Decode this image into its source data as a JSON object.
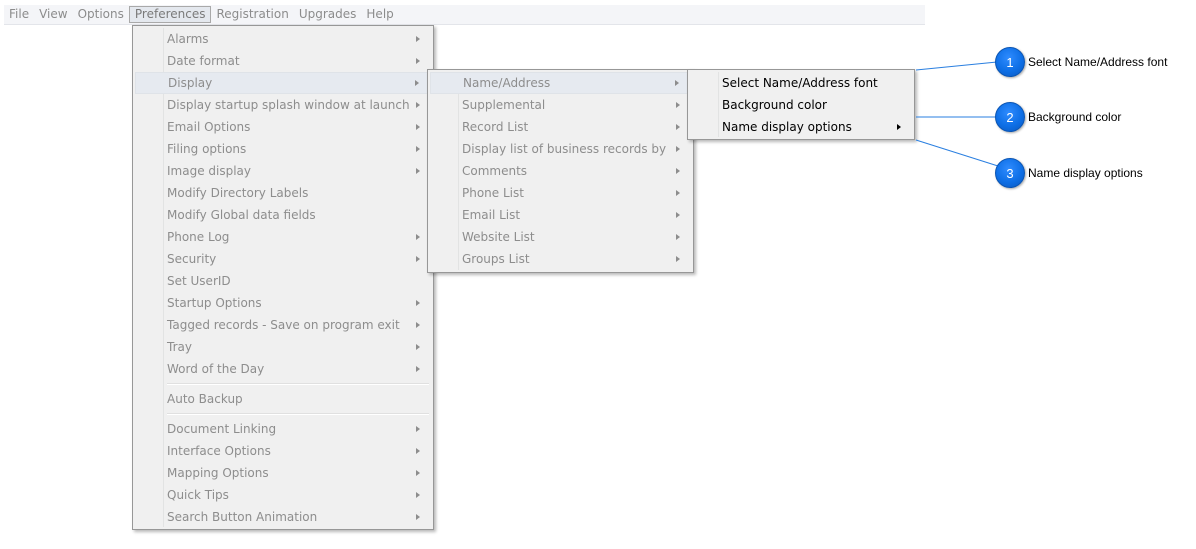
{
  "menubar": {
    "items": [
      {
        "label": "File"
      },
      {
        "label": "View"
      },
      {
        "label": "Options"
      },
      {
        "label": "Preferences"
      },
      {
        "label": "Registration"
      },
      {
        "label": "Upgrades"
      },
      {
        "label": "Help"
      }
    ]
  },
  "preferences_menu": {
    "items": [
      {
        "label": "Alarms"
      },
      {
        "label": "Date format"
      },
      {
        "label": "Display"
      },
      {
        "label": "Display startup splash window at launch"
      },
      {
        "label": "Email Options"
      },
      {
        "label": "Filing options"
      },
      {
        "label": "Image display"
      },
      {
        "label": "Modify Directory Labels"
      },
      {
        "label": "Modify Global data fields"
      },
      {
        "label": "Phone Log"
      },
      {
        "label": "Security"
      },
      {
        "label": "Set UserID"
      },
      {
        "label": "Startup Options"
      },
      {
        "label": "Tagged records - Save on program exit"
      },
      {
        "label": "Tray"
      },
      {
        "label": "Word of the Day"
      },
      {
        "label": "Auto Backup"
      },
      {
        "label": "Document Linking"
      },
      {
        "label": "Interface Options"
      },
      {
        "label": "Mapping Options"
      },
      {
        "label": "Quick Tips"
      },
      {
        "label": "Search Button Animation"
      }
    ]
  },
  "display_menu": {
    "items": [
      {
        "label": "Name/Address"
      },
      {
        "label": "Supplemental"
      },
      {
        "label": "Record List"
      },
      {
        "label": "Display list of business records by"
      },
      {
        "label": "Comments"
      },
      {
        "label": "Phone List"
      },
      {
        "label": "Email List"
      },
      {
        "label": "Website List"
      },
      {
        "label": "Groups List"
      }
    ]
  },
  "name_address_menu": {
    "items": [
      {
        "label": "Select Name/Address font"
      },
      {
        "label": "Background color"
      },
      {
        "label": "Name display options"
      }
    ]
  },
  "callouts": [
    {
      "number": "1",
      "text": "Select Name/Address font"
    },
    {
      "number": "2",
      "text": "Background color"
    },
    {
      "number": "3",
      "text": "Name display options"
    }
  ],
  "colors": {
    "badge": "#0e6fe6",
    "leader_line": "#2a7fe0",
    "menu_bg": "#f0f0f0",
    "disabled_text": "#8d8d8d"
  }
}
